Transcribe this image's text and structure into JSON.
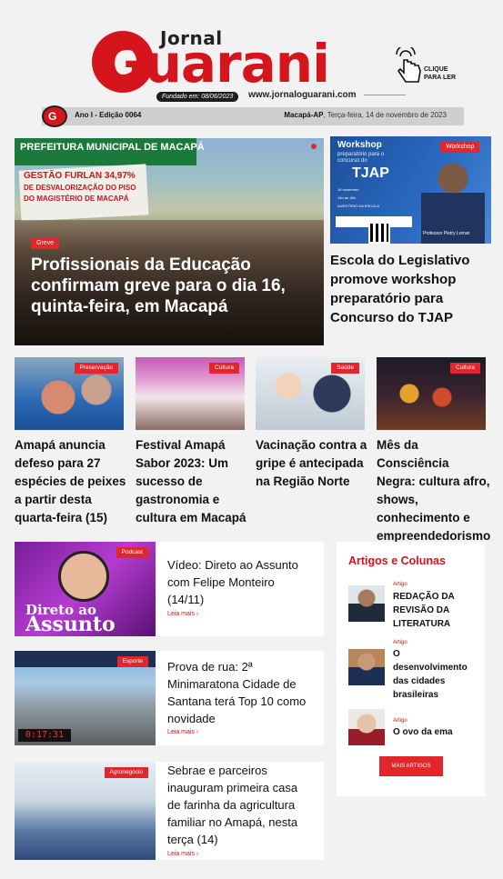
{
  "header": {
    "logo_top": "Jornal",
    "logo_main": "Guarani",
    "founded": "Fundado em: 08/06/2023",
    "url": "www.jornaloguarani.com",
    "click_line1": "CLIQUE",
    "click_line2": "PARA LER",
    "edition": "Ano I - Edição 0064",
    "location": "Macapá-AP",
    "date": ", Terça-feira, 14 de novembro de 2023"
  },
  "hero": {
    "tag": "Greve",
    "title": "Profissionais da Educação confirmam greve para o dia 16, quinta-feira, em Macapá",
    "photo_banner": "PREFEITURA MUNICIPAL DE MACAPÁ",
    "sign_line1": "GESTÃO FURLAN 34,97%",
    "sign_line2": "DE DESVALORIZAÇÃO DO PISO",
    "sign_line3": "DO MAGISTÉRIO DE MACAPÁ"
  },
  "side_feature": {
    "tag": "Workshop",
    "img_title": "Workshop",
    "img_sub": "preparatório para o concurso do",
    "img_tjap": "TJAP",
    "img_list": "16 novembro\n14h às 18h\nAUDITÓRIO DA ESCOLA",
    "img_prof": "Professor Pietry Lorran",
    "title": "Escola do Legislativo promove workshop preparatório para Concurso do TJAP"
  },
  "cards": [
    {
      "tag": "Preservação",
      "title": "Amapá anuncia defeso para 27 espécies de peixes a partir desta quarta-feira (15)"
    },
    {
      "tag": "Cultura",
      "title": "Festival Amapá Sabor 2023: Um sucesso de gastronomia e cultura em Macapá"
    },
    {
      "tag": "Saúde",
      "title": "Vacinação contra a gripe é antecipada na Região Norte"
    },
    {
      "tag": "Cultura",
      "title": "Mês da Consciência Negra: cultura afro, shows, conhecimento e empreendedorismo"
    }
  ],
  "list": [
    {
      "tag": "Podcast",
      "title": "Vídeo: Direto ao Assunto com Felipe Monteiro (14/11)",
      "more": "Leia mais ›",
      "img_text1": "Direto ao",
      "img_text2": "Assunto"
    },
    {
      "tag": "Esporte",
      "title": "Prova de rua: 2ª Minimaratona Cidade de Santana terá Top 10 como novidade",
      "more": "Leia mais ›",
      "img_clock": "0:17:31"
    },
    {
      "tag": "Agronegócio",
      "title": "Sebrae e parceiros inauguram primeira casa de farinha da agricultura familiar no Amapá, nesta terça (14)",
      "more": "Leia mais ›"
    }
  ],
  "articles": {
    "heading": "Artigos e Colunas",
    "items": [
      {
        "kicker": "Artigo",
        "title": "REDAÇÃO DA REVISÃO DA LITERATURA"
      },
      {
        "kicker": "Artigo",
        "title": "O desenvolvimento das cidades brasileiras"
      },
      {
        "kicker": "Artigo",
        "title": "O ovo da ema"
      }
    ],
    "button": "MAIS ARTIGOS"
  },
  "colors": {
    "accent": "#d6141b",
    "tag": "#e2262c"
  }
}
